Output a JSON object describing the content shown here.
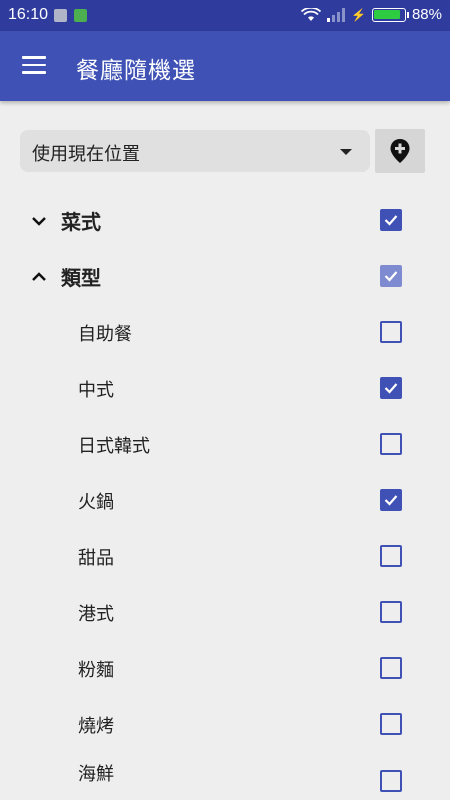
{
  "status_bar": {
    "time": "16:10",
    "battery": "88%",
    "battery_level": 0.88,
    "icons": [
      "gallery-icon",
      "android-icon",
      "wifi-icon",
      "signal-icon",
      "charging-icon",
      "battery-icon"
    ]
  },
  "app_bar": {
    "title": "餐廳隨機選",
    "menu_icon": "menu-icon"
  },
  "location": {
    "selected": "使用現在位置",
    "pin_icon": "add-location-pin-icon"
  },
  "groups": [
    {
      "label": "菜式",
      "expanded": false,
      "state": "checked"
    },
    {
      "label": "類型",
      "expanded": true,
      "state": "partial"
    }
  ],
  "items": [
    {
      "label": "自助餐",
      "checked": false
    },
    {
      "label": "中式",
      "checked": true
    },
    {
      "label": "日式韓式",
      "checked": false
    },
    {
      "label": "火鍋",
      "checked": true
    },
    {
      "label": "甜品",
      "checked": false
    },
    {
      "label": "港式",
      "checked": false
    },
    {
      "label": "粉麵",
      "checked": false
    },
    {
      "label": "燒烤",
      "checked": false
    },
    {
      "label": "海鮮",
      "checked": false
    }
  ],
  "colors": {
    "primary": "#3f51b5",
    "status_bar": "#2f3c9e",
    "background": "#eeeeee"
  }
}
